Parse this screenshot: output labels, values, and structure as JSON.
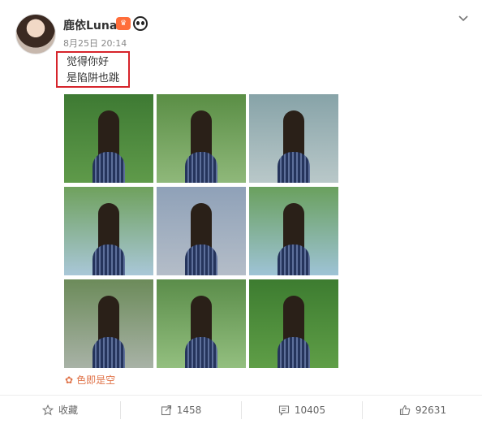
{
  "post": {
    "username": "鹿依Luna",
    "timestamp": "8月25日 20:14",
    "text_lines": [
      "觉得你好",
      "是陷阱也跳"
    ],
    "tag": "色即是空"
  },
  "photos": [
    {
      "bg": "#5f9a4a",
      "top": "#3e7a33"
    },
    {
      "bg": "#8fb87a",
      "top": "#5a8e45"
    },
    {
      "bg": "#b9c8c9",
      "top": "#87a3a8"
    },
    {
      "bg": "#a9c7d8",
      "top": "#6fa15d"
    },
    {
      "bg": "#b4bdc8",
      "top": "#8fa1b8"
    },
    {
      "bg": "#9ec3d6",
      "top": "#6aa05e"
    },
    {
      "bg": "#a8b2a6",
      "top": "#6c8b5a"
    },
    {
      "bg": "#93bf7f",
      "top": "#5b8d4a"
    },
    {
      "bg": "#5f9e47",
      "top": "#3d7c30"
    }
  ],
  "actions": {
    "favorite": "收藏",
    "repost": "1458",
    "comment": "10405",
    "like": "92631"
  },
  "colors": {
    "highlight_box": "#d6242b",
    "tag": "#e0744a",
    "muted_text": "#888888"
  }
}
